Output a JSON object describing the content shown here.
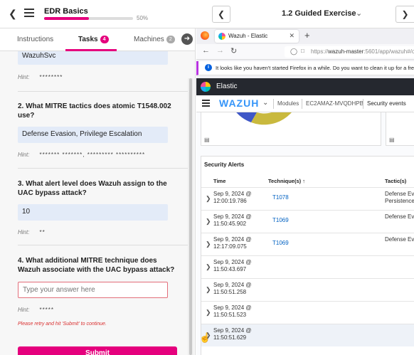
{
  "header": {
    "course_title": "EDR Basics",
    "progress_percent": 50,
    "progress_label": "50%",
    "exercise_title": "1.2 Guided Exercise"
  },
  "tabs": [
    {
      "label": "Instructions"
    },
    {
      "label": "Tasks",
      "badge": "4",
      "badge_color": "#e5007d"
    },
    {
      "label": "Machines",
      "badge": "2",
      "badge_color": "#aaaaaa"
    }
  ],
  "tasks": {
    "prev_answer": "WazuhSvc",
    "prev_hint": "********",
    "hint_label": "Hint:",
    "q2": {
      "question": "2. What MITRE tactics does atomic T1548.002 use?",
      "answer": "Defense Evasion, Privilege Escalation",
      "hint": "******* *******, ********* **********"
    },
    "q3": {
      "question": "3. What alert level does Wazuh assign to the UAC bypass attack?",
      "answer": "10",
      "hint": "**"
    },
    "q4": {
      "question": "4. What additional MITRE technique does Wazuh associate with the UAC bypass attack?",
      "placeholder": "Type your answer here",
      "hint": "*****",
      "retry_message": "Please retry and hit 'Submit' to continue."
    },
    "submit_label": "Submit"
  },
  "browser": {
    "tab_title": "Wazuh - Elastic",
    "url_prefix": "https://",
    "url_host": "wazuh-master",
    "url_rest": ":5601/app/wazuh#/o",
    "notice": "It looks like you haven't started Firefox in a while. Do you want to clean it up for a fresh, like-new",
    "elastic_label": "Elastic",
    "wazuh_logo": "WAZUH",
    "breadcrumbs": [
      "Modules",
      "EC2AMAZ-MVQDHPB",
      "Security events"
    ],
    "alerts": {
      "title": "Security Alerts",
      "columns": [
        "Time",
        "Technique(s) ↑",
        "Tactic(s)"
      ],
      "rows": [
        {
          "time": "Sep 9, 2024 @ 12:00:19.786",
          "technique": "T1078",
          "tactic": "Defense Eva\nPersistence"
        },
        {
          "time": "Sep 9, 2024 @ 11:50:45.902",
          "technique": "T1069",
          "tactic": "Defense Eva"
        },
        {
          "time": "Sep 9, 2024 @ 12:17:09.075",
          "technique": "T1069",
          "tactic": "Defense Eva"
        },
        {
          "time": "Sep 9, 2024 @ 11:50:43.697",
          "technique": "",
          "tactic": ""
        },
        {
          "time": "Sep 9, 2024 @ 11:50:51.258",
          "technique": "",
          "tactic": ""
        },
        {
          "time": "Sep 9, 2024 @ 11:50:51.523",
          "technique": "",
          "tactic": ""
        },
        {
          "time": "Sep 9, 2024 @ 11:50:51.629",
          "technique": "",
          "tactic": ""
        }
      ]
    }
  },
  "colors": {
    "accent": "#e5007d",
    "error": "#d93030",
    "link": "#0061c2",
    "wazuh_blue": "#3595f9",
    "donut_blue": "#3f57c7",
    "donut_olive": "#c9b93e"
  }
}
